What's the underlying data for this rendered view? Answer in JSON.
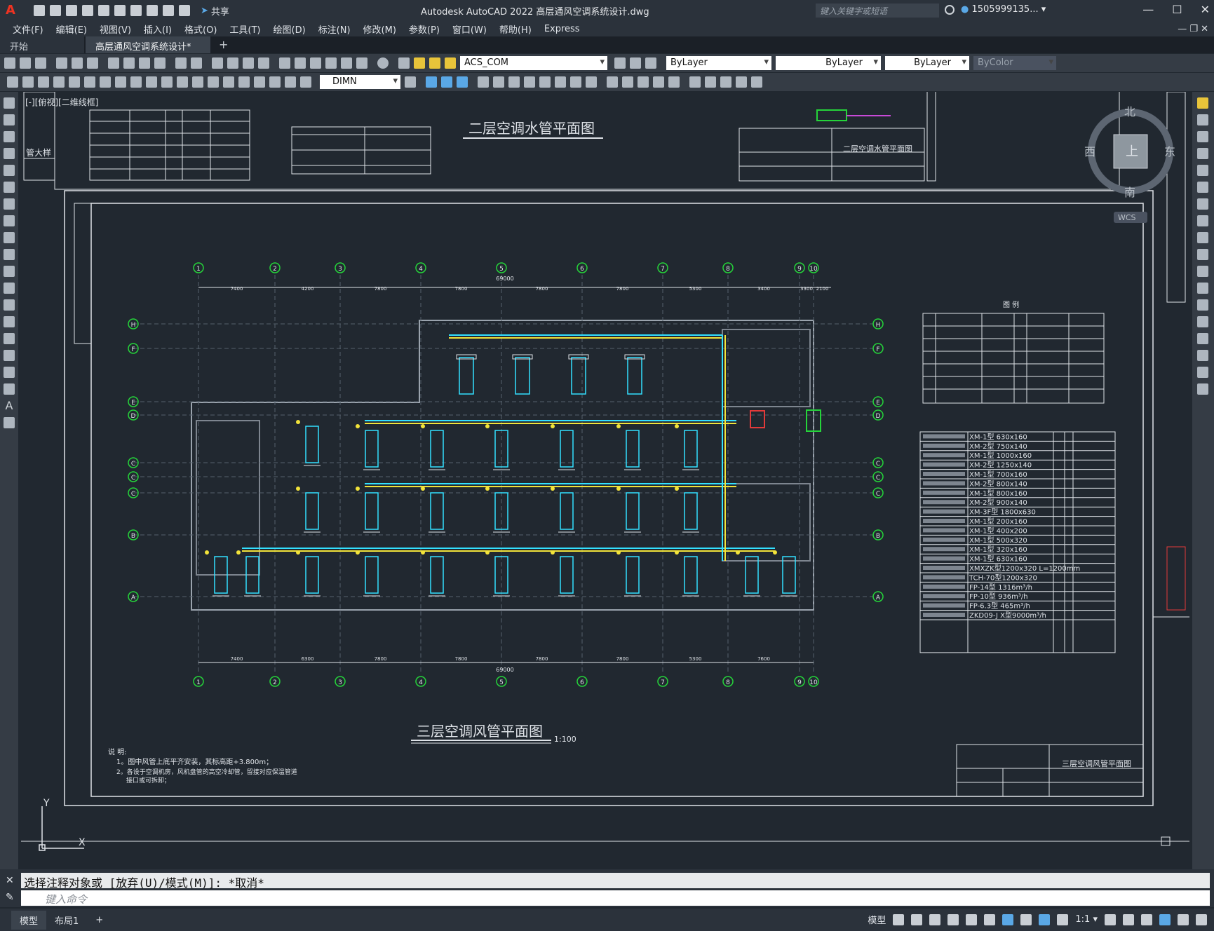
{
  "app": {
    "title": "Autodesk AutoCAD 2022    高层通风空调系统设计.dwg",
    "logo": "A",
    "share": "共享"
  },
  "search": {
    "placeholder": "键入关键字或短语"
  },
  "user": {
    "name": "1505999135... ▾"
  },
  "menu": {
    "items": [
      "文件(F)",
      "编辑(E)",
      "视图(V)",
      "插入(I)",
      "格式(O)",
      "工具(T)",
      "绘图(D)",
      "标注(N)",
      "修改(M)",
      "参数(P)",
      "窗口(W)",
      "帮助(H)",
      "Express"
    ]
  },
  "tabs": {
    "start": "开始",
    "file": "高层通风空调系统设计* ✕",
    "add": "+"
  },
  "toolbar": {
    "textstyle": "ACS_COM",
    "layer_color": "ByLayer",
    "linetype": "ByLayer",
    "lineweight": "ByLayer",
    "plotstyle": "ByColor",
    "dimstyle": "DIMN"
  },
  "viewport": {
    "label": "[-][俯视][二维线框]"
  },
  "viewcube": {
    "north": "北",
    "south": "南",
    "west": "西",
    "east": "东",
    "top": "上",
    "wcs": "WCS"
  },
  "drawing": {
    "upper_title": "二层空调水管平面图",
    "upper_titleblock": "二层空调水管平面图",
    "main_title": "三层空调风管平面图",
    "scale": "1:100",
    "titleblock": "三层空调风管平面图",
    "detail": "管大样",
    "legend_title": "图 例",
    "notes_title": "说 明:",
    "note1": "1。图中风管上底平齐安装，其标高距+3.800m；",
    "note2": "2。各设于空调机房，风机盘管的高空冷却管，留接对应保温管道",
    "note3": "接口或可拆卸；",
    "overall_dim": "69000",
    "grid_cols": [
      "1",
      "2",
      "3",
      "4",
      "5",
      "6",
      "7",
      "8",
      "9",
      "10"
    ],
    "grid_rows": [
      "A",
      "B",
      "C",
      "D",
      "E",
      "F",
      "H"
    ],
    "dims_top": [
      "7400",
      "4200",
      "7800",
      "7800",
      "7800",
      "7800",
      "5300",
      "3400",
      "3300",
      "2100"
    ],
    "dims_bottom": [
      "7400",
      "6300",
      "7800",
      "7800",
      "7800",
      "7800",
      "5300",
      "7600"
    ],
    "equip_rows": [
      "XM-1型 630x160",
      "XM-2型 750x140",
      "XM-1型 1000x160",
      "XM-2型 1250x140",
      "XM-1型 700x160",
      "XM-2型 800x140",
      "XM-1型 800x160",
      "XM-2型 900x140",
      "XM-3F型 1800x630",
      "XM-1型 200x160",
      "XM-1型 400x200",
      "XM-1型 500x320",
      "XM-1型 320x160",
      "XM-1型 630x160",
      "XMXZK型1200x320  L=1200mm",
      "TCH-70型1200x320",
      "FP-14型 1316m³/h",
      "FP-10型 936m³/h",
      "FP-6.3型 465m³/h",
      "ZKD09-J X型9000m³/h"
    ],
    "ucs_y": "Y",
    "ucs_x": "X"
  },
  "command": {
    "history": "选择注释对象或 [放弃(U)/模式(M)]: *取消*",
    "placeholder": "键入命令"
  },
  "status": {
    "model_tab": "模型",
    "layout_tab": "布局1",
    "add": "+",
    "model": "模型",
    "scale": "1:1 ▾"
  },
  "colors": {
    "accent": "#5aa8e6",
    "background": "#212830",
    "duct_cyan": "#33e0ff",
    "duct_yellow": "#f2e33a",
    "grid_green": "#25d43a",
    "duct_red": "#e23a3a"
  }
}
